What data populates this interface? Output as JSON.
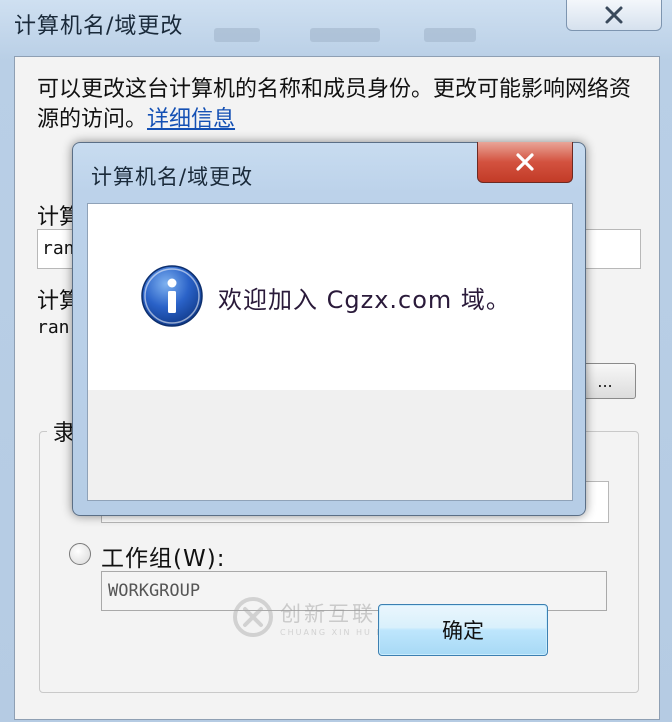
{
  "outer_window": {
    "title": "计算机名/域更改",
    "description": "可以更改这台计算机的名称和成员身份。更改可能影响网络资源的访问。",
    "details_link": "详细信息",
    "computer_name_label_partial": "计算",
    "computer_name_value_partial": "ran",
    "full_name_label_partial": "计算",
    "full_name_value_partial": "ran",
    "more_button": "...",
    "member_of_label_partial": "隶",
    "workgroup_radio_label": "工作组(W):",
    "workgroup_value": "WORKGROUP"
  },
  "dialog": {
    "title": "计算机名/域更改",
    "message": "欢迎加入 Cgzx.com 域。",
    "ok_button": "确定",
    "icon": "info-icon"
  },
  "watermark": {
    "text_cn": "创新互联",
    "text_en": "CHUANG XIN HU LIAN"
  },
  "colors": {
    "title_bar": "#bcd2ea",
    "close_red": "#c23b27",
    "link": "#1450b4",
    "ok_button_border": "#3c7fb1"
  }
}
